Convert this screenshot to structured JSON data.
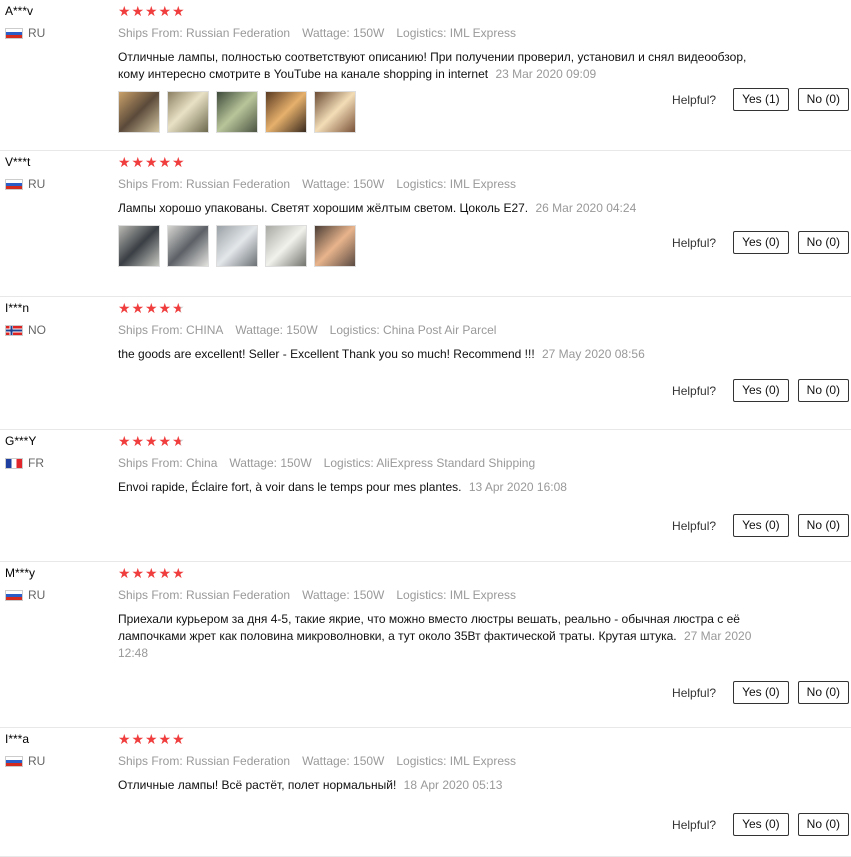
{
  "reviews": [
    {
      "name": "A***v",
      "country": "RU",
      "flag": "ru",
      "rating": 5,
      "ships_from_label": "Ships From:",
      "ships_from": "Russian Federation",
      "wattage_label": "Wattage:",
      "wattage": "150W",
      "logistics_label": "Logistics:",
      "logistics": "IML Express",
      "text": "Отличные лампы, полностью соответствуют описанию! При получении проверил, установил и снял видеообзор, кому интересно смотрите в YouTube на канале shopping in internet",
      "date": "23 Mar 2020 09:09",
      "photos": 5,
      "helpful_label": "Helpful?",
      "yes_label": "Yes (1)",
      "no_label": "No (0)"
    },
    {
      "name": "V***t",
      "country": "RU",
      "flag": "ru",
      "rating": 5,
      "ships_from_label": "Ships From:",
      "ships_from": "Russian Federation",
      "wattage_label": "Wattage:",
      "wattage": "150W",
      "logistics_label": "Logistics:",
      "logistics": "IML Express",
      "text": "Лампы хорошо упакованы. Светят хорошим жёлтым светом. Цоколь Е27.",
      "date": "26 Mar 2020 04:24",
      "photos": 5,
      "helpful_label": "Helpful?",
      "yes_label": "Yes (0)",
      "no_label": "No (0)"
    },
    {
      "name": "I***n",
      "country": "NO",
      "flag": "no",
      "rating": 4.5,
      "ships_from_label": "Ships From:",
      "ships_from": "CHINA",
      "wattage_label": "Wattage:",
      "wattage": "150W",
      "logistics_label": "Logistics:",
      "logistics": "China Post Air Parcel",
      "text": "the goods are excellent! Seller - Excellent Thank you so much! Recommend !!!",
      "date": "27 May 2020 08:56",
      "photos": 0,
      "helpful_label": "Helpful?",
      "yes_label": "Yes (0)",
      "no_label": "No (0)"
    },
    {
      "name": "G***Y",
      "country": "FR",
      "flag": "fr",
      "rating": 4.5,
      "ships_from_label": "Ships From:",
      "ships_from": "China",
      "wattage_label": "Wattage:",
      "wattage": "150W",
      "logistics_label": "Logistics:",
      "logistics": "AliExpress Standard Shipping",
      "text": "Envoi rapide, Éclaire fort, à voir dans le temps pour mes plantes.",
      "date": "13 Apr 2020 16:08",
      "photos": 0,
      "helpful_label": "Helpful?",
      "yes_label": "Yes (0)",
      "no_label": "No (0)"
    },
    {
      "name": "M***y",
      "country": "RU",
      "flag": "ru",
      "rating": 5,
      "ships_from_label": "Ships From:",
      "ships_from": "Russian Federation",
      "wattage_label": "Wattage:",
      "wattage": "150W",
      "logistics_label": "Logistics:",
      "logistics": "IML Express",
      "text": "Приехали курьером за дня 4-5, такие якрие, что можно вместо люстры вешать, реально - обычная люстра с её лампочками жрет как половина микроволновки, а тут около 35Вт фактической траты. Крутая штука.",
      "date": "27 Mar 2020 12:48",
      "photos": 0,
      "helpful_label": "Helpful?",
      "yes_label": "Yes (0)",
      "no_label": "No (0)"
    },
    {
      "name": "I***a",
      "country": "RU",
      "flag": "ru",
      "rating": 5,
      "ships_from_label": "Ships From:",
      "ships_from": "Russian Federation",
      "wattage_label": "Wattage:",
      "wattage": "150W",
      "logistics_label": "Logistics:",
      "logistics": "IML Express",
      "text": "Отличные лампы! Всё растёт, полет нормальный!",
      "date": "18 Apr 2020 05:13",
      "photos": 0,
      "helpful_label": "Helpful?",
      "yes_label": "Yes (0)",
      "no_label": "No (0)"
    }
  ]
}
